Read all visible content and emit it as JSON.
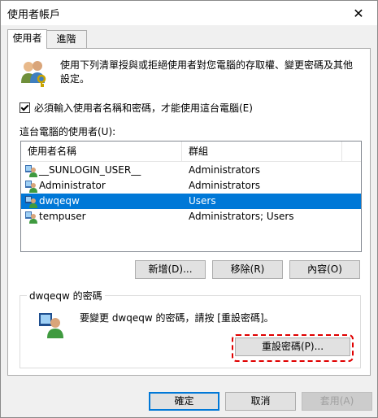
{
  "window": {
    "title": "使用者帳戶",
    "close_glyph": "✕"
  },
  "tabs": [
    {
      "label": "使用者",
      "active": true
    },
    {
      "label": "進階",
      "active": false
    }
  ],
  "intro_text": "使用下列清單授與或拒絕使用者對您電腦的存取權、變更密碼及其他設定。",
  "checkbox": {
    "label": "必須輸入使用者名稱和密碼，才能使用這台電腦(E)",
    "checked": true
  },
  "users_list": {
    "label": "這台電腦的使用者(U):",
    "columns": [
      "使用者名稱",
      "群組"
    ],
    "rows": [
      {
        "name": "__SUNLOGIN_USER__",
        "group": "Administrators",
        "selected": false
      },
      {
        "name": "Administrator",
        "group": "Administrators",
        "selected": false
      },
      {
        "name": "dwqeqw",
        "group": "Users",
        "selected": true
      },
      {
        "name": "tempuser",
        "group": "Administrators; Users",
        "selected": false
      }
    ]
  },
  "list_buttons": {
    "add": "新增(D)...",
    "remove": "移除(R)",
    "properties": "內容(O)"
  },
  "password_group": {
    "title": "dwqeqw 的密碼",
    "text": "要變更 dwqeqw 的密碼，請按 [重設密碼]。",
    "reset_button": "重設密碼(P)..."
  },
  "footer": {
    "ok": "確定",
    "cancel": "取消",
    "apply": "套用(A)"
  },
  "colors": {
    "selection": "#0078d7",
    "highlight_border": "#e00000"
  }
}
